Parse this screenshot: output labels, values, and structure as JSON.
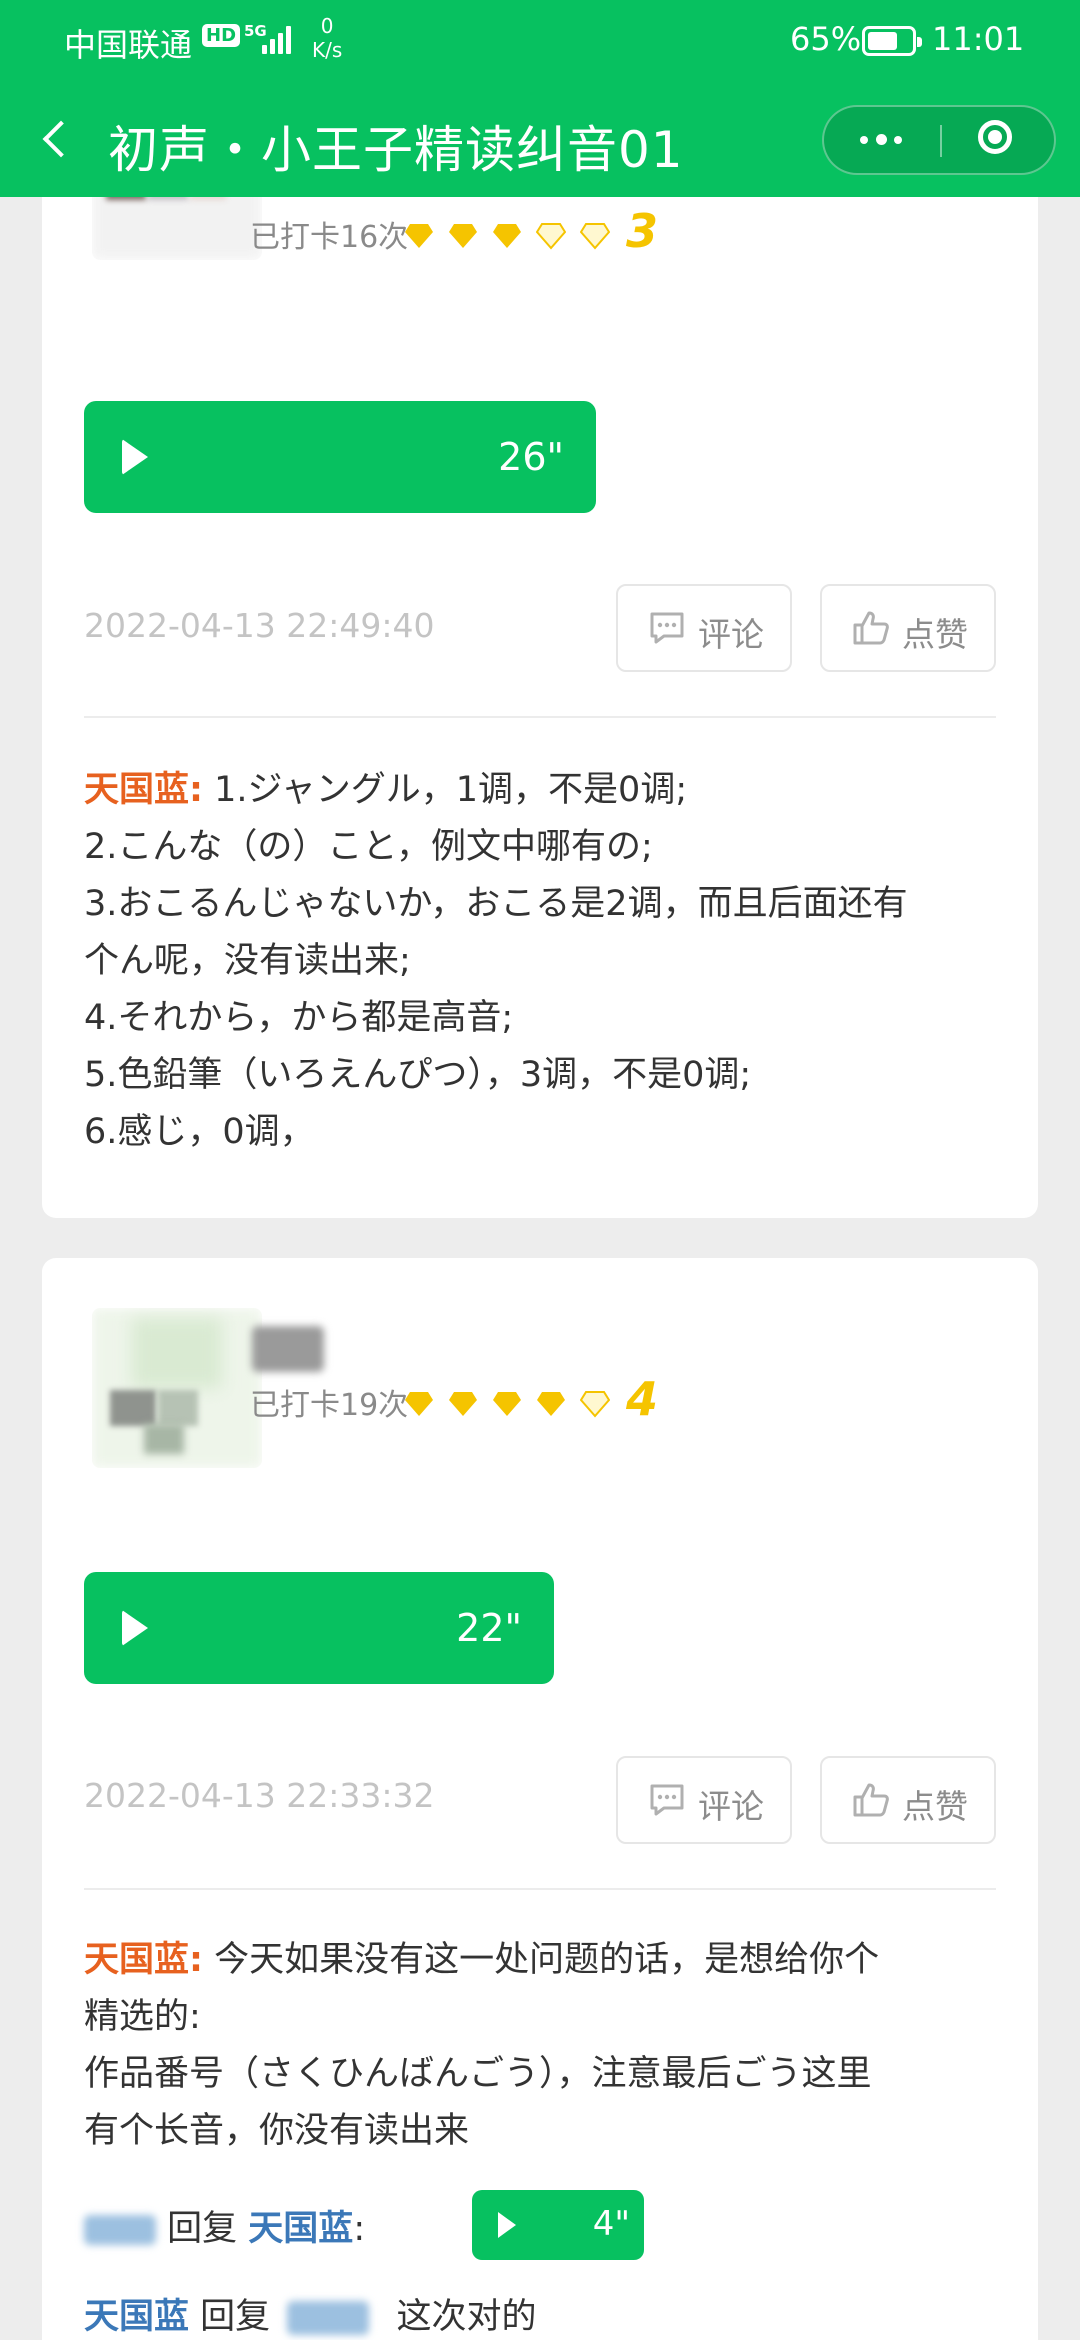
{
  "status_bar": {
    "carrier": "中国联通",
    "hd": "HD",
    "network": "5G",
    "speed_value": "0",
    "speed_unit": "K/s",
    "battery": "65%",
    "time": "11:01"
  },
  "nav": {
    "title": "初声・小王子精读纠音01"
  },
  "posts": [
    {
      "clock_text": "已打卡16次",
      "level": "3",
      "voice_duration": "26\"",
      "timestamp": "2022-04-13 22:49:40",
      "comment_label": "评论",
      "like_label": "点赞",
      "commenter": "天国蓝:",
      "comment_lines": [
        "1.ジャングル，1调，不是0调;",
        "2.こんな（の）こと，例文中哪有の;",
        "3.おこるんじゃないか，おこる是2调，而且后面还有",
        "个ん呢，没有读出来;",
        "4.それから，から都是高音;",
        "5.色鉛筆（いろえんぴつ），3调，不是0调;",
        "6.感じ，0调，"
      ]
    },
    {
      "clock_text": "已打卡19次",
      "level": "4",
      "voice_duration": "22\"",
      "timestamp": "2022-04-13 22:33:32",
      "comment_label": "评论",
      "like_label": "点赞",
      "commenter": "天国蓝:",
      "comment_lines": [
        "今天如果没有这一处问题的话，是想给你个",
        "精选的:",
        "作品番号（さくひんばんごう），注意最后ごう这里",
        "有个长音，你没有读出来"
      ],
      "replies": [
        {
          "verb": "回复",
          "target": "天国蓝",
          "colon": ":",
          "voice_duration": "4\""
        },
        {
          "from": "天国蓝",
          "verb": "回复",
          "text": "这次对的"
        }
      ]
    }
  ],
  "colors": {
    "brand_green": "#07c160",
    "commenter_orange": "#e7611f",
    "reply_blue": "#3b78b8",
    "level_yellow": "#f5c400"
  },
  "icons": {
    "back": "chevron-left-icon",
    "more": "more-dots-icon",
    "close": "target-circle-icon",
    "comment": "comment-bubble-icon",
    "like": "thumbs-up-icon",
    "play": "play-icon",
    "diamond": "diamond-icon"
  }
}
